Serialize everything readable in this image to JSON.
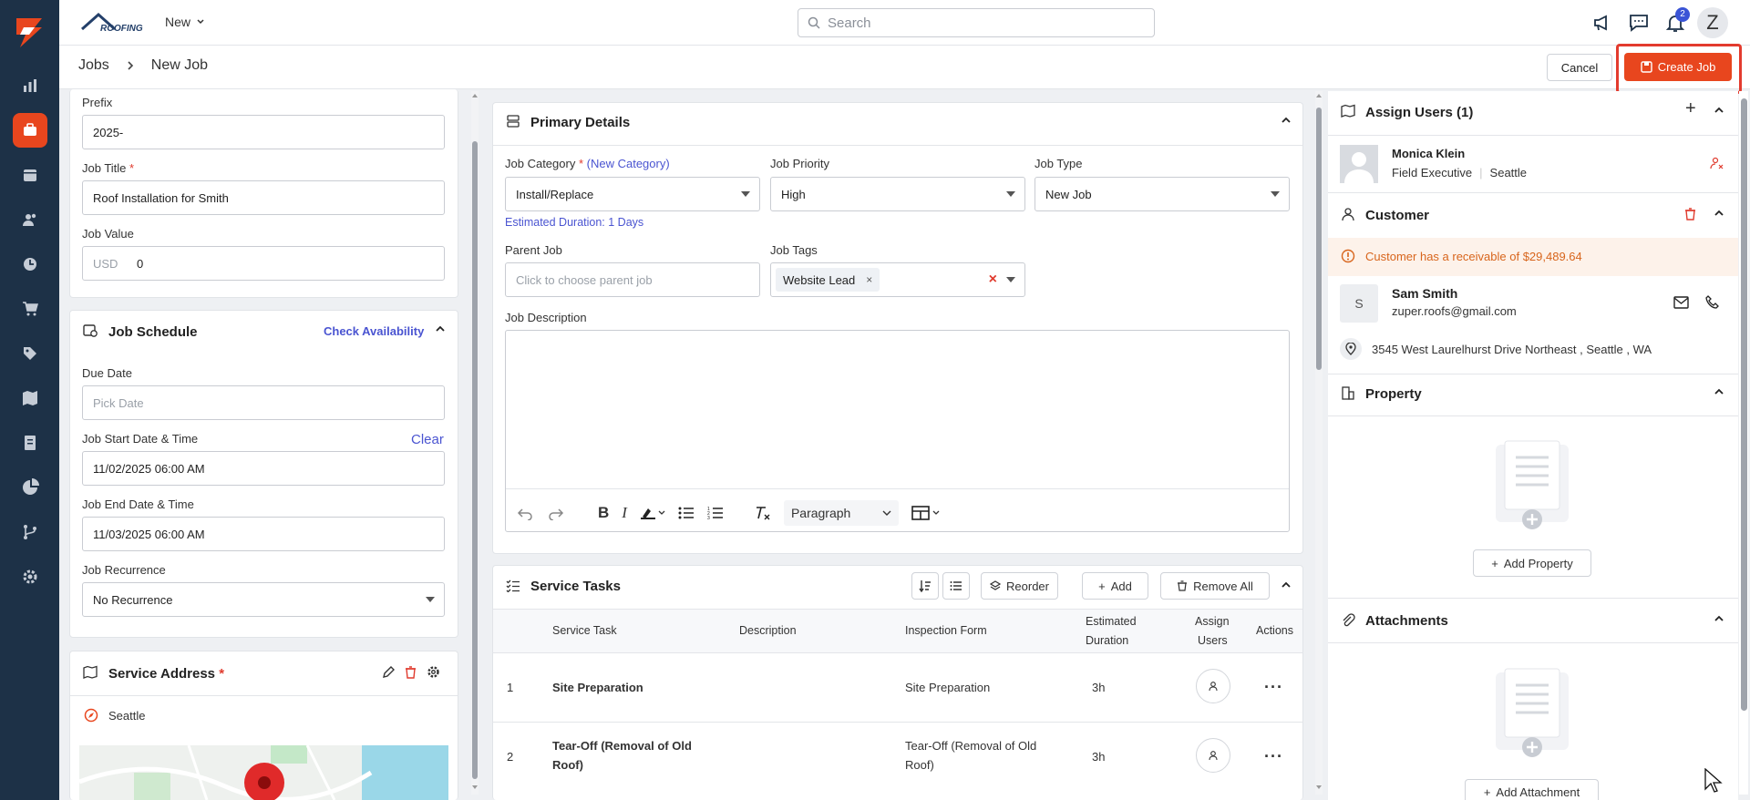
{
  "app": {
    "brand": "ROOFING",
    "new_menu": "New",
    "search_placeholder": "Search",
    "notifications_count": "2",
    "user_initial": "Z"
  },
  "breadcrumb": {
    "root": "Jobs",
    "current": "New Job"
  },
  "actions": {
    "cancel": "Cancel",
    "create": "Create Job"
  },
  "left": {
    "prefix_label": "Prefix",
    "prefix_value": "2025-",
    "title_label": "Job Title",
    "title_value": "Roof Installation for Smith",
    "value_label": "Job Value",
    "value_currency": "USD",
    "value_amount": "0",
    "schedule": {
      "title": "Job Schedule",
      "check_link": "Check Availability",
      "due_label": "Due Date",
      "due_placeholder": "Pick Date",
      "start_label": "Job Start Date & Time",
      "start_clear": "Clear",
      "start_value": "11/02/2025 06:00 AM",
      "end_label": "Job End Date & Time",
      "end_value": "11/03/2025 06:00 AM",
      "recurrence_label": "Job Recurrence",
      "recurrence_value": "No Recurrence"
    },
    "service_address": {
      "title": "Service Address",
      "city": "Seattle"
    }
  },
  "primary": {
    "title": "Primary Details",
    "category_label": "Job Category",
    "new_category": "(New Category)",
    "category_value": "Install/Replace",
    "estimated": "Estimated Duration: 1 Days",
    "priority_label": "Job Priority",
    "priority_value": "High",
    "type_label": "Job Type",
    "type_value": "New Job",
    "parent_label": "Parent Job",
    "parent_placeholder": "Click to choose parent job",
    "tags_label": "Job Tags",
    "tag": "Website Lead",
    "desc_label": "Job Description",
    "editor_block": "Paragraph"
  },
  "tasks": {
    "title": "Service Tasks",
    "reorder": "Reorder",
    "add": "Add",
    "remove_all": "Remove All",
    "headers": [
      "Service Task",
      "Description",
      "Inspection Form",
      "Estimated",
      "Duration",
      "Assign",
      "Users",
      "Actions"
    ],
    "rows": [
      {
        "n": "1",
        "task": "Site Preparation",
        "form": "Site Preparation",
        "dur": "3h"
      },
      {
        "n": "2",
        "task_l1": "Tear-Off (Removal of Old",
        "task_l2": "Roof)",
        "form_l1": "Tear-Off (Removal of Old",
        "form_l2": "Roof)",
        "dur": "3h"
      }
    ]
  },
  "right": {
    "assign_title": "Assign Users (1)",
    "user_name": "Monica Klein",
    "user_role": "Field Executive",
    "user_city": "Seattle",
    "customer_title": "Customer",
    "receivable": "Customer has a receivable of $29,489.64",
    "cust_initial": "S",
    "cust_name": "Sam Smith",
    "cust_email": "zuper.roofs@gmail.com",
    "cust_address": "3545 West Laurelhurst Drive Northeast , Seattle , WA",
    "property_title": "Property",
    "add_property": "Add Property",
    "attachments_title": "Attachments",
    "add_attachment": "Add Attachment"
  },
  "colors": {
    "accent": "#e8461e",
    "rail": "#1d3147",
    "link": "#4a54d1",
    "danger": "#e03b2e",
    "warn_bg": "#fdf2ea",
    "warn_text": "#d8651c"
  }
}
